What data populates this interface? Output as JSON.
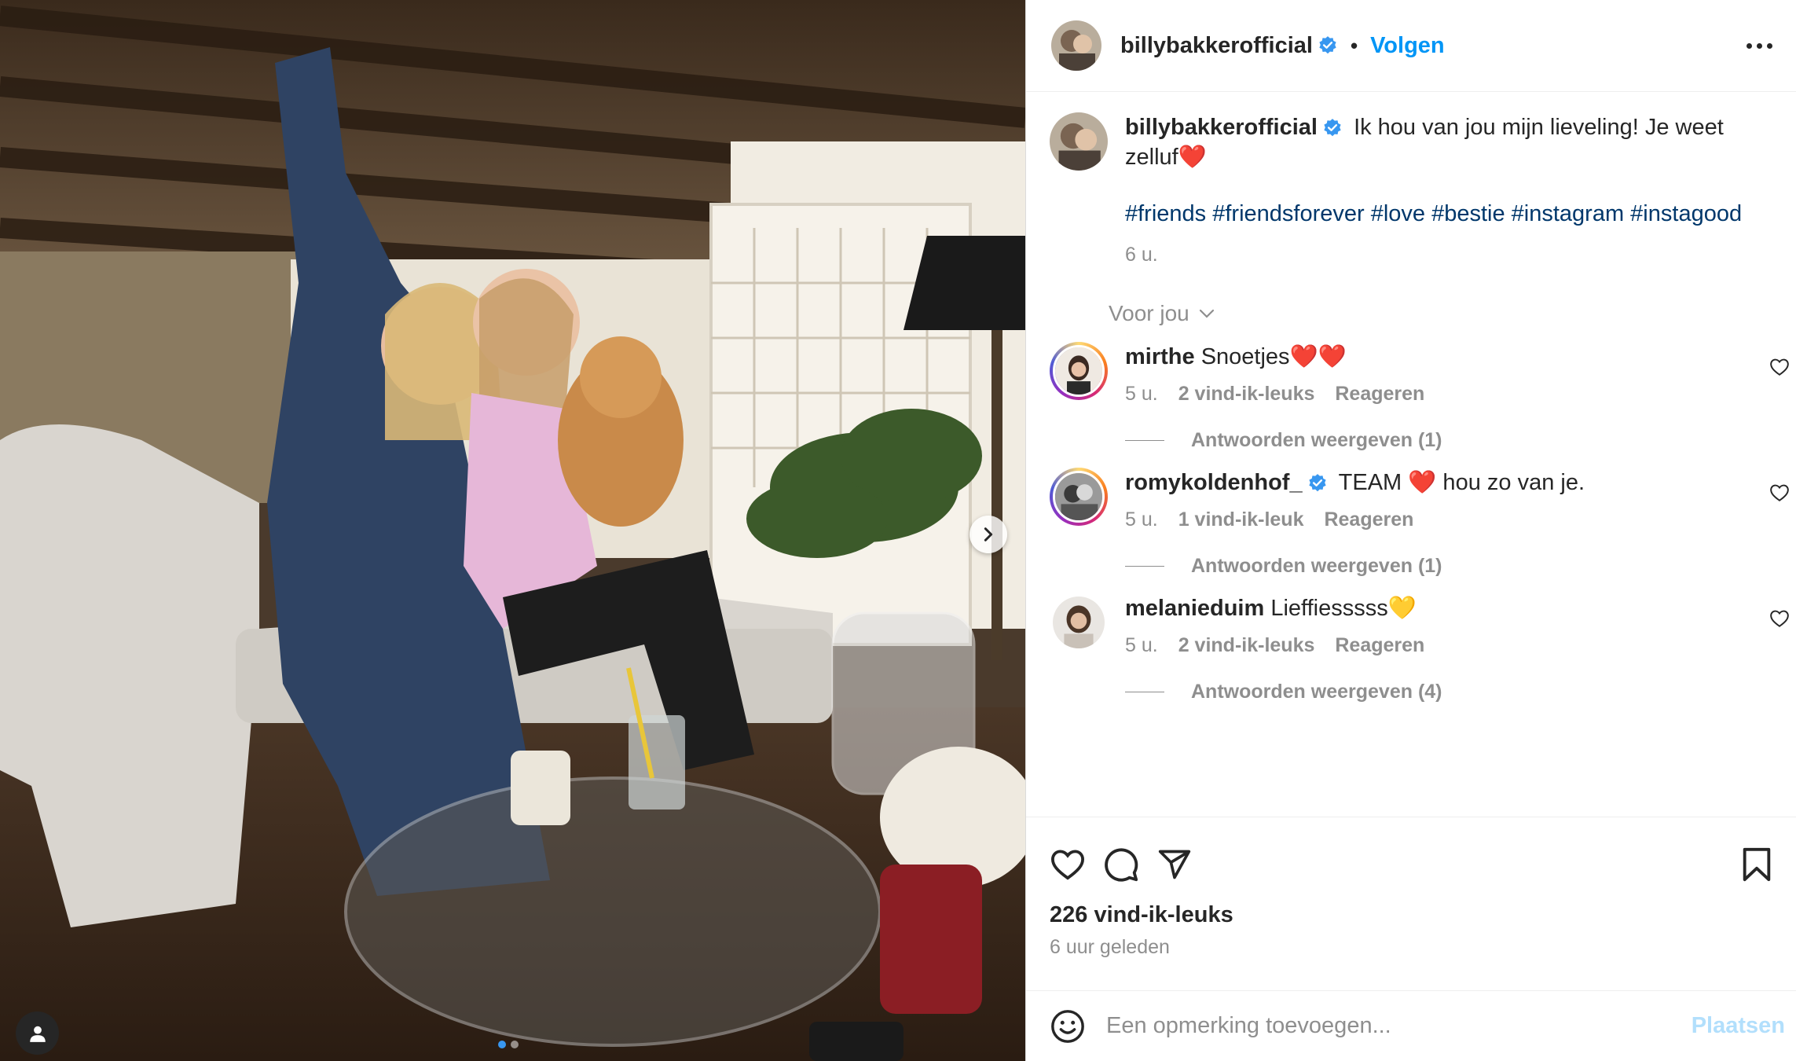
{
  "post": {
    "username": "billybakkerofficial",
    "separator": "•",
    "follow_label": "Volgen",
    "caption_text": "Ik hou van jou mijn lieveling! Je weet zelluf❤️",
    "hashtags": "#friends #friendsforever #love #bestie #instagram #instagood",
    "caption_time": "6 u."
  },
  "for_you_label": "Voor jou",
  "comments": [
    {
      "username": "mirthe",
      "text": "Snoetjes❤️❤️",
      "time": "5 u.",
      "likes": "2 vind-ik-leuks",
      "reply": "Reageren",
      "view_replies": "Antwoorden weergeven (1)",
      "verified": false
    },
    {
      "username": "romykoldenhof_",
      "text": "TEAM ❤️ hou zo van je.",
      "time": "5 u.",
      "likes": "1 vind-ik-leuk",
      "reply": "Reageren",
      "view_replies": "Antwoorden weergeven (1)",
      "verified": true
    },
    {
      "username": "melanieduim",
      "text": "Lieffiesssss💛",
      "time": "5 u.",
      "likes": "2 vind-ik-leuks",
      "reply": "Reageren",
      "view_replies": "Antwoorden weergeven (4)",
      "verified": false
    }
  ],
  "footer": {
    "likes_count": "226 vind-ik-leuks",
    "posted_ago": "6 uur geleden",
    "comment_placeholder": "Een opmerking toevoegen...",
    "post_label": "Plaatsen"
  },
  "colors": {
    "accent": "#0095f6",
    "verified": "#3897f0",
    "hashtag": "#00376b",
    "muted": "#8e8e8e"
  },
  "icons": [
    "chevron-right-icon",
    "user-tag-icon",
    "verified-icon",
    "more-icon",
    "chevron-down-icon",
    "heart-icon",
    "comment-icon",
    "share-icon",
    "bookmark-icon",
    "emoji-icon"
  ]
}
